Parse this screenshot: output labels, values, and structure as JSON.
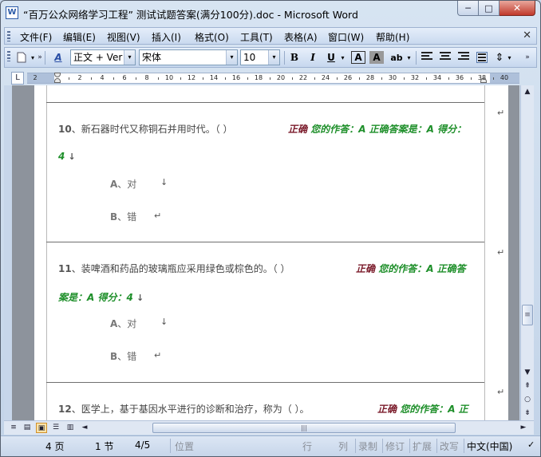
{
  "window": {
    "app_icon_label": "W",
    "title": "“百万公众网络学习工程” 测试试题答案(满分100分).doc - Microsoft Word",
    "minimize_glyph": "─",
    "maximize_glyph": "□",
    "close_glyph": "✕"
  },
  "menubar": {
    "items": [
      "文件(F)",
      "编辑(E)",
      "视图(V)",
      "插入(I)",
      "格式(O)",
      "工具(T)",
      "表格(A)",
      "窗口(W)",
      "帮助(H)"
    ],
    "close_glyph": "✕"
  },
  "toolbar": {
    "style_icon_label": "A",
    "style_value": "正文 + Ver",
    "font_value": "宋体",
    "size_value": "10",
    "bold_label": "B",
    "italic_label": "I",
    "underline_label": "U",
    "border_char_label": "A",
    "shade_char_label": "A",
    "highlight_label": "ab",
    "dropdown_glyph": "▾"
  },
  "ruler": {
    "corner_glyph": "L",
    "numbers": [
      "2",
      "2",
      "4",
      "6",
      "8",
      "10",
      "12",
      "14",
      "16",
      "18",
      "20",
      "22",
      "24",
      "26",
      "28",
      "30",
      "32",
      "34",
      "36",
      "38",
      "40"
    ]
  },
  "document": {
    "questions": [
      {
        "number": "10",
        "text": "、新石器时代又称铜石并用时代。（  ）",
        "result": "正确",
        "answer_line1": "您的作答：A  正确答案是：A  得分：",
        "answer_line2": "4",
        "options": [
          {
            "letter": "A",
            "text": "、对"
          },
          {
            "letter": "B",
            "text": "、错"
          }
        ]
      },
      {
        "number": "11",
        "text": "、装啤酒和药品的玻璃瓶应采用绿色或棕色的。（  ）",
        "result": "正确",
        "answer_line1": "您的作答：A  正确答",
        "answer_line2": "案是：A  得分：4",
        "options": [
          {
            "letter": "A",
            "text": "、对"
          },
          {
            "letter": "B",
            "text": "、错"
          }
        ]
      },
      {
        "number": "12",
        "text": "、医学上，基于基因水平进行的诊断和治疗，称为（  ）。",
        "result": "正确",
        "answer_line1": "您的作答：A  正"
      }
    ],
    "paragraph_mark": "↵",
    "line_mark": "↓"
  },
  "scrollbar": {
    "up_glyph": "▲",
    "down_glyph": "▼",
    "prev_page_glyph": "⇞",
    "browse_glyph": "○",
    "next_page_glyph": "⇟",
    "thumb_grip": "≡",
    "left_glyph": "◄",
    "right_glyph": "►",
    "hthumb_grip": "|||"
  },
  "view_buttons": [
    "≡",
    "▤",
    "▣",
    "☰",
    "▥"
  ],
  "statusbar": {
    "page": "4 页",
    "section": "1 节",
    "page_of": "4/5",
    "position": "位置",
    "line": "行",
    "column": "列",
    "record": "录制",
    "revise": "修订",
    "extend": "扩展",
    "overwrite": "改写",
    "language": "中文(中国)",
    "spell_icon": "✓"
  },
  "colors": {
    "result_red": "#7a1a2a",
    "answer_green": "#1e8f2a",
    "page_background": "#8d939c"
  }
}
